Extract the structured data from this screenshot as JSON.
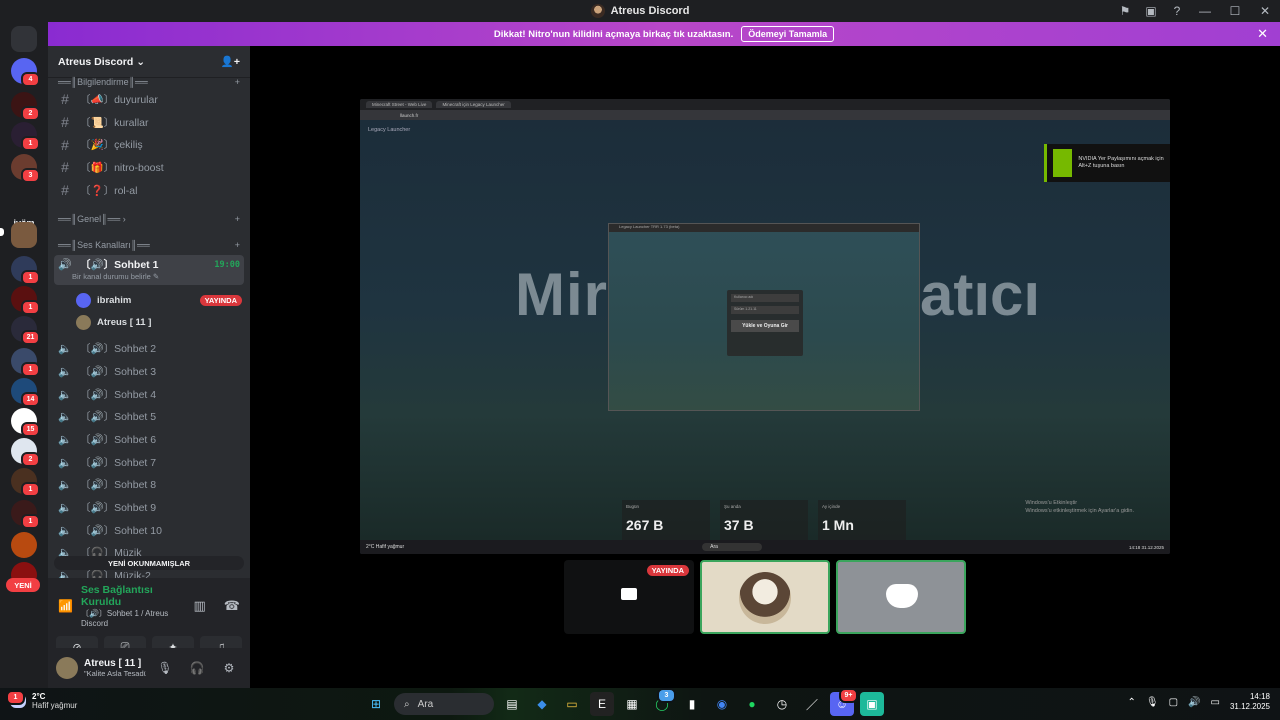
{
  "window": {
    "title": "Atreus Discord"
  },
  "banner": {
    "text": "Dikkat! Nitro'nun kilidini açmaya birkaç tık uzaktasın.",
    "button": "Ödemeyi Tamamla"
  },
  "rail": {
    "ivom_label": "ivöm",
    "new_label": "YENİ",
    "badges": [
      "4",
      "2",
      "1",
      "3",
      "1",
      "1",
      "21",
      "1",
      "14",
      "15",
      "2",
      "1",
      "1"
    ]
  },
  "sidebar": {
    "guild_name": "Atreus Discord",
    "categories": {
      "info": "══║Bilgilendirme║══",
      "general": "══║Genel║══",
      "voice": "══║Ses Kanalları║══"
    },
    "text_channels": [
      "〔📣〕duyurular",
      "〔📜〕kurallar",
      "〔🎉〕çekiliş",
      "〔🎁〕nitro-boost",
      "〔❓〕rol-al"
    ],
    "active_voice": {
      "name": "〔🔊〕Sohbet 1",
      "time": "19:00",
      "status": "Bir kanal durumu belirle"
    },
    "voice_users": [
      {
        "name": "ibrahim",
        "live": "YAYINDA"
      },
      {
        "name": "Atreus [ 11 ]"
      }
    ],
    "voice_channels": [
      "〔🔊〕Sohbet 2",
      "〔🔊〕Sohbet 3",
      "〔🔊〕Sohbet 4",
      "〔🔊〕Sohbet 5",
      "〔🔊〕Sohbet 6",
      "〔🔊〕Sohbet 7",
      "〔🔊〕Sohbet 8",
      "〔🔊〕Sohbet 9",
      "〔🔊〕Sohbet 10",
      "〔🎧〕Müzik",
      "〔🎧〕Müzik-2"
    ],
    "unread_label": "YENİ OKUNMAMIŞLAR"
  },
  "voice_panel": {
    "connected": "Ses Bağlantısı Kuruldu",
    "channel": "〔🔊〕Sohbet 1 / Atreus Discord",
    "user_name": "Atreus [ 11 ]",
    "user_status": "\"Kalite Asla Tesadüf Değild..."
  },
  "stream": {
    "browser_tab1": "Minecraft Street - Web Live",
    "browser_tab2": "Minecraft için Legacy Launcher",
    "url": "llaunch.fr",
    "app_title": "Legacy Launcher",
    "hero_left": "Mir",
    "hero_right": "atıcı",
    "nvidia_text": "NVIDIA Yer Paylaşımını açmak için Alt+Z tuşuna basın",
    "dialog_title": "Legacy Launcher TRR 1.73 (beta)",
    "login_field1": "Kullanıcı adı",
    "login_field2": "Sürüm 1.21.11",
    "login_button": "Yükle ve Oyuna Gir",
    "stats": [
      {
        "label": "Bugün",
        "value": "267 B"
      },
      {
        "label": "Şu anda",
        "value": "37 B"
      },
      {
        "label": "Ay içinde",
        "value": "1 Mn"
      }
    ],
    "activation": [
      "Windows'u Etkinleştir",
      "Windows'u etkinleştirmek için Ayarlar'a gidin."
    ],
    "inner_taskbar_weather": "2°C Hafif yağmur",
    "inner_search": "Ara",
    "inner_clock": "14:18 31.12.2025"
  },
  "thumbs": {
    "live_label": "YAYINDA"
  },
  "taskbar": {
    "weather_temp": "2°C",
    "weather_desc": "Hafif yağmur",
    "search": "Ara",
    "time": "14:18",
    "date": "31.12.2025",
    "weather_badge": "1",
    "whatsapp_badge": "3",
    "discord_badge": "9+"
  },
  "colors": {
    "accent_green": "#23a55a",
    "live_red": "#da373c",
    "banner": "#b847c8"
  }
}
